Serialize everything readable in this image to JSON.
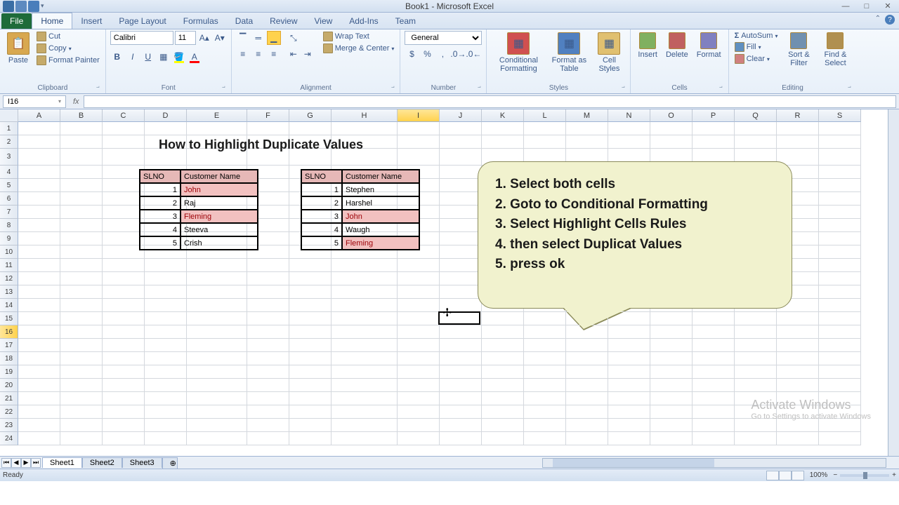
{
  "app": {
    "title": "Book1 - Microsoft Excel"
  },
  "win": {
    "min": "—",
    "max": "□",
    "close": "✕"
  },
  "tabs": {
    "file": "File",
    "items": [
      "Home",
      "Insert",
      "Page Layout",
      "Formulas",
      "Data",
      "Review",
      "View",
      "Add-Ins",
      "Team"
    ],
    "active": 0
  },
  "ribbon": {
    "clipboard": {
      "label": "Clipboard",
      "paste": "Paste",
      "cut": "Cut",
      "copy": "Copy",
      "painter": "Format Painter"
    },
    "font": {
      "label": "Font",
      "name": "Calibri",
      "size": "11",
      "bold": "B",
      "italic": "I",
      "underline": "U"
    },
    "alignment": {
      "label": "Alignment",
      "wrap": "Wrap Text",
      "merge": "Merge & Center"
    },
    "number": {
      "label": "Number",
      "format": "General"
    },
    "styles": {
      "label": "Styles",
      "cond": "Conditional Formatting",
      "table": "Format as Table",
      "cell": "Cell Styles"
    },
    "cells": {
      "label": "Cells",
      "insert": "Insert",
      "delete": "Delete",
      "format": "Format"
    },
    "editing": {
      "label": "Editing",
      "autosum": "AutoSum",
      "fill": "Fill",
      "clear": "Clear",
      "sort": "Sort & Filter",
      "find": "Find & Select"
    }
  },
  "namebox": "I16",
  "columns": [
    "A",
    "B",
    "C",
    "D",
    "E",
    "F",
    "G",
    "H",
    "I",
    "J",
    "K",
    "L",
    "M",
    "N",
    "O",
    "P",
    "Q",
    "R",
    "S"
  ],
  "selected_col": "I",
  "selected_row": 16,
  "title_text": "How to Highlight  Duplicate Values",
  "table1": {
    "headers": [
      "SLNO",
      "Customer Name"
    ],
    "rows": [
      {
        "sl": "1",
        "name": "John",
        "dup": true
      },
      {
        "sl": "2",
        "name": "Raj",
        "dup": false
      },
      {
        "sl": "3",
        "name": "Fleming",
        "dup": true
      },
      {
        "sl": "4",
        "name": "Steeva",
        "dup": false
      },
      {
        "sl": "5",
        "name": "Crish",
        "dup": false
      }
    ]
  },
  "table2": {
    "headers": [
      "SLNO",
      "Customer Name"
    ],
    "rows": [
      {
        "sl": "1",
        "name": "Stephen",
        "dup": false
      },
      {
        "sl": "2",
        "name": "Harshel",
        "dup": false
      },
      {
        "sl": "3",
        "name": "John",
        "dup": true
      },
      {
        "sl": "4",
        "name": "Waugh",
        "dup": false
      },
      {
        "sl": "5",
        "name": "Fleming",
        "dup": true
      }
    ]
  },
  "callout": [
    "1. Select both cells",
    "2. Goto to Conditional Formatting",
    "3. Select Highlight Cells Rules",
    "4. then select Duplicat Values",
    "5. press ok"
  ],
  "watermark": {
    "l1": "Activate Windows",
    "l2": "Go to Settings to activate Windows"
  },
  "sheets": [
    "Sheet1",
    "Sheet2",
    "Sheet3"
  ],
  "active_sheet": 0,
  "status": {
    "ready": "Ready",
    "zoom": "100%"
  }
}
